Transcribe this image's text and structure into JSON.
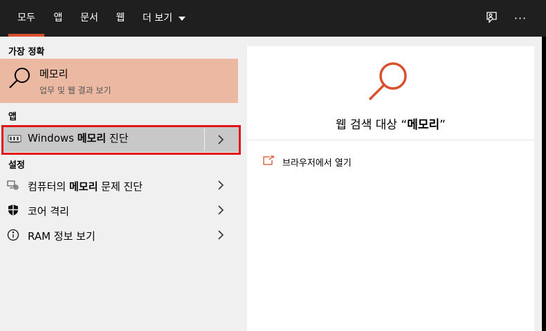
{
  "tabs": [
    {
      "label": "모두",
      "active": true
    },
    {
      "label": "앱"
    },
    {
      "label": "문서"
    },
    {
      "label": "웹"
    },
    {
      "label": "더 보기"
    }
  ],
  "top_icons": [
    "feedback-icon",
    "more-icon"
  ],
  "more_glyph": "···",
  "sections": {
    "best_match": "가장 정확",
    "apps": "앱",
    "settings": "설정"
  },
  "best_match": {
    "title": "메모리",
    "subtitle": "업무 및 웹 결과 보기"
  },
  "app_item": {
    "prefix": "Windows ",
    "bold": "메모리",
    "suffix": " 진단"
  },
  "settings_items": [
    {
      "prefix": "컴퓨터의 ",
      "bold": "메모리",
      "suffix": " 문제 진단",
      "icon": "computer-gear-icon"
    },
    {
      "prefix": "코어 격리",
      "bold": "",
      "suffix": "",
      "icon": "shield-icon"
    },
    {
      "prefix": "RAM 정보 보기",
      "bold": "",
      "suffix": "",
      "icon": "info-icon"
    }
  ],
  "web": {
    "title_prefix": "웹 검색 대상 “",
    "title_bold": "메모리",
    "title_suffix": "”",
    "open_label": "브라우저에서 열기"
  },
  "colors": {
    "accent": "#d9512c",
    "best_bg": "#ebb8a2",
    "selected_bg": "#c8c8c8",
    "highlight": "#e0151c"
  }
}
